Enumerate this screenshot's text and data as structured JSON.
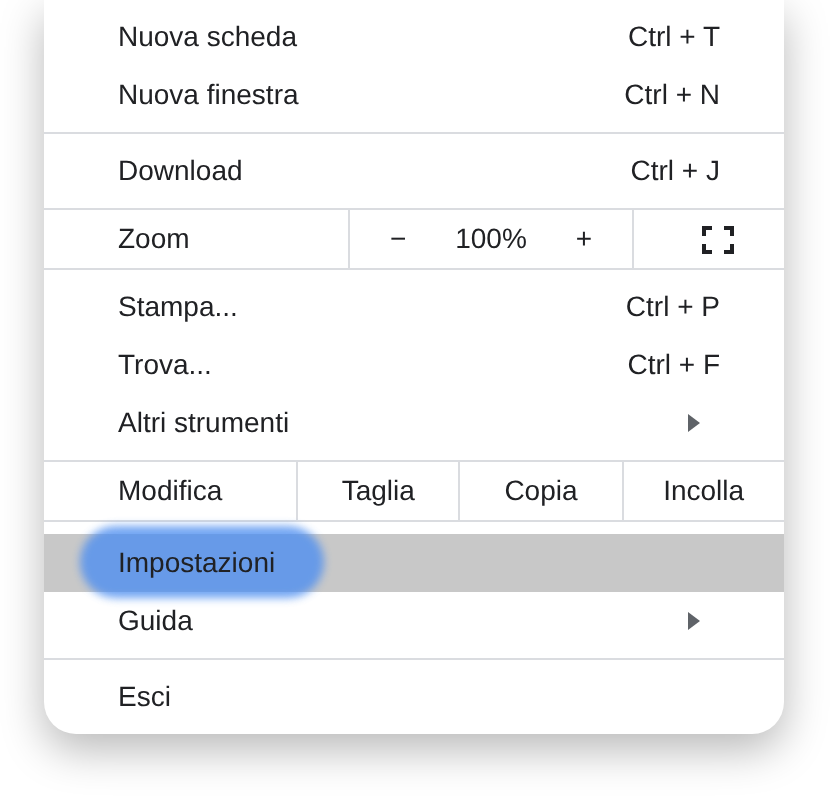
{
  "menu": {
    "items": [
      {
        "kind": "item",
        "label": "Nuova scheda",
        "shortcut": "Ctrl + T",
        "submenu": false,
        "selected": false
      },
      {
        "kind": "item",
        "label": "Nuova finestra",
        "shortcut": "Ctrl + N",
        "submenu": false,
        "selected": false
      },
      {
        "kind": "separator"
      },
      {
        "kind": "item",
        "label": "Download",
        "shortcut": "Ctrl + J",
        "submenu": false,
        "selected": false
      },
      {
        "kind": "zoom",
        "label": "Zoom",
        "minus": "−",
        "value": "100%",
        "plus": "+"
      },
      {
        "kind": "item",
        "label": "Stampa...",
        "shortcut": "Ctrl + P",
        "submenu": false,
        "selected": false
      },
      {
        "kind": "item",
        "label": "Trova...",
        "shortcut": "Ctrl + F",
        "submenu": false,
        "selected": false
      },
      {
        "kind": "item",
        "label": "Altri strumenti",
        "submenu": true,
        "selected": false
      },
      {
        "kind": "edit",
        "label": "Modifica",
        "actions": [
          "Taglia",
          "Copia",
          "Incolla"
        ]
      },
      {
        "kind": "item",
        "label": "Impostazioni",
        "submenu": false,
        "selected": true
      },
      {
        "kind": "item",
        "label": "Guida",
        "submenu": true,
        "selected": false
      },
      {
        "kind": "separator"
      },
      {
        "kind": "item",
        "label": "Esci",
        "submenu": false,
        "selected": false
      }
    ]
  }
}
